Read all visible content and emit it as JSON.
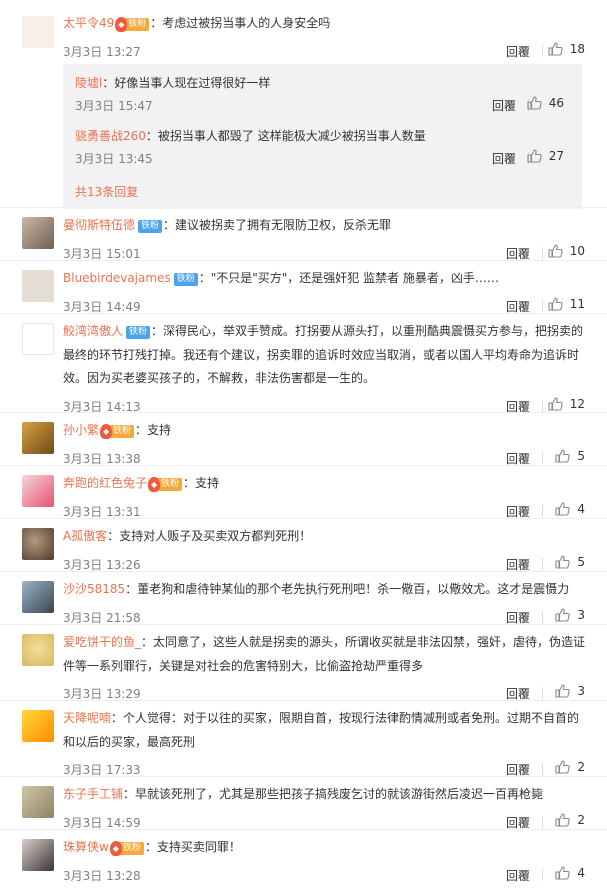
{
  "reply_label": "回覆",
  "badges": {
    "tiefen": "铁粉"
  },
  "comments": [
    {
      "user": "太平令49",
      "badge": "vip",
      "text": "：考虑过被拐当事人的人身安全吗",
      "time": "3月3日 13:27",
      "likes": "18"
    },
    {
      "user": "曼彻斯特伍德",
      "badge": "tiefen",
      "text": "：建议被拐卖了拥有无限防卫权，反杀无罪",
      "time": "3月3日 15:01",
      "likes": "10"
    },
    {
      "user": "Bluebirdevajames",
      "badge": "tiefen",
      "text": "：\"不只是\"买方\"，还是强奸犯 监禁者 施暴者，凶手……",
      "time": "3月3日 14:49",
      "likes": "11"
    },
    {
      "user": "鲛湾湾傲人",
      "badge": "tiefen",
      "text": "：深得民心，举双手赞成。打拐要从源头打，以重刑酷典震慑买方参与，把拐卖的最终的环节打残打掉。我还有个建议，拐卖罪的追诉时效应当取消，或者以国人平均寿命为追诉时效。因为买老婆买孩子的，不解救，非法伤害都是一生的。",
      "time": "3月3日 14:13",
      "likes": "12"
    },
    {
      "user": "孙小繁",
      "badge": "vip",
      "text": "：支持",
      "time": "3月3日 13:38",
      "likes": "5"
    },
    {
      "user": "奔跑的红色兔子",
      "badge": "vip",
      "text": "：支持",
      "time": "3月3日 13:31",
      "likes": "4"
    },
    {
      "user": "A孤傲客",
      "badge": "",
      "text": "：支持对人贩子及买卖双方都判死刑！",
      "time": "3月3日 13:26",
      "likes": "5"
    },
    {
      "user": "沙沙58185",
      "badge": "",
      "text": "：董老狗和虐待钟某仙的那个老先执行死刑吧！杀一儆百，以儆效尤。这才是震慑力",
      "time": "3月3日 21:58",
      "likes": "3"
    },
    {
      "user": "爱吃饼干的鱼_",
      "badge": "",
      "text": "：太同意了，这些人就是拐卖的源头，所谓收买就是非法囚禁，强奸，虐待，伪造证件等一系列罪行，关键是对社会的危害特别大，比偷盗抢劫严重得多",
      "time": "3月3日 13:29",
      "likes": "3"
    },
    {
      "user": "天降呢喃",
      "badge": "",
      "text": "：个人觉得：对于以往的买家，限期自首，按现行法律酌情减刑或者免刑。过期不自首的和以后的买家，最高死刑",
      "time": "3月3日 17:33",
      "likes": "2"
    },
    {
      "user": "东子手工铺",
      "badge": "",
      "text": "：早就该死刑了，尤其是那些把孩子搞残废乞讨的就该游街然后凌迟一百再枪毙",
      "time": "3月3日 14:59",
      "likes": "2"
    },
    {
      "user": "珠算侠w",
      "badge": "vip",
      "text": "：支持买卖同罪！",
      "time": "3月3日 13:28",
      "likes": "4"
    }
  ],
  "sub_replies": [
    {
      "user": "陵墟l",
      "text": "：好像当事人现在过得很好一样",
      "time": "3月3日 15:47",
      "likes": "46"
    },
    {
      "user": "骁勇善战260",
      "text": "：被拐当事人都毁了 这样能极大减少被拐当事人数量",
      "time": "3月3日 13:45",
      "likes": "27"
    }
  ],
  "more_replies": "共13条回复",
  "colors": {
    "username": "#eb7350",
    "badge_blue": "#4da3e9",
    "badge_orange": "#f7a83a",
    "time": "#808080",
    "subbox_bg": "#f2f2f5"
  },
  "icons": {
    "like": "thumbs-up-icon",
    "vip_badge": "vip-fan-badge"
  }
}
